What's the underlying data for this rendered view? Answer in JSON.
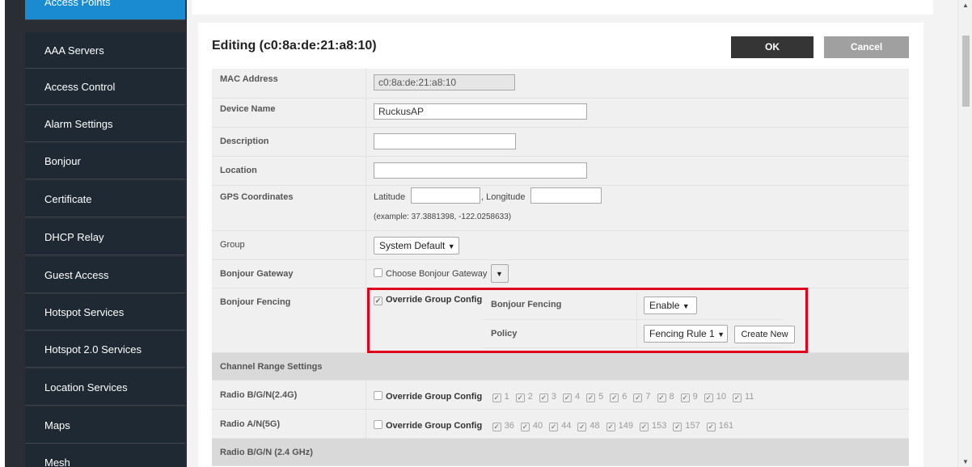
{
  "sidebar": {
    "items": [
      {
        "label": "Access Points",
        "active": true
      },
      {
        "label": "AAA Servers"
      },
      {
        "label": "Access Control"
      },
      {
        "label": "Alarm Settings"
      },
      {
        "label": "Bonjour"
      },
      {
        "label": "Certificate"
      },
      {
        "label": "DHCP Relay"
      },
      {
        "label": "Guest Access"
      },
      {
        "label": "Hotspot Services"
      },
      {
        "label": "Hotspot 2.0 Services"
      },
      {
        "label": "Location Services"
      },
      {
        "label": "Maps"
      },
      {
        "label": "Mesh"
      }
    ]
  },
  "editor": {
    "title": "Editing (c0:8a:de:21:a8:10)",
    "ok_label": "OK",
    "cancel_label": "Cancel"
  },
  "fields": {
    "mac_label": "MAC Address",
    "mac_value": "c0:8a:de:21:a8:10",
    "device_name_label": "Device Name",
    "device_name_value": "RuckusAP",
    "description_label": "Description",
    "description_value": "",
    "location_label": "Location",
    "location_value": "",
    "gps_label": "GPS Coordinates",
    "latitude_label": "Latitude",
    "latitude_value": "",
    "longitude_label": ", Longitude",
    "longitude_value": "",
    "gps_example": "(example: 37.3881398, -122.0258633)",
    "group_label": "Group",
    "group_value": "System Default",
    "bonjour_gateway_label": "Bonjour Gateway",
    "bonjour_gateway_checkbox": "Choose Bonjour Gateway",
    "bonjour_fencing_label": "Bonjour Fencing",
    "fencing_override_label": "Override Group Config",
    "fencing_sub_label": "Bonjour Fencing",
    "fencing_value": "Enable",
    "policy_label": "Policy",
    "policy_value": "Fencing Rule 1",
    "create_new_label": "Create New"
  },
  "channels": {
    "section_title": "Channel Range Settings",
    "radio_24_label": "Radio B/G/N(2.4G)",
    "radio_5_label": "Radio A/N(5G)",
    "override_label": "Override Group Config",
    "channels_24": [
      "1",
      "2",
      "3",
      "4",
      "5",
      "6",
      "7",
      "8",
      "9",
      "10",
      "11"
    ],
    "channels_5": [
      "36",
      "40",
      "44",
      "48",
      "149",
      "153",
      "157",
      "161"
    ],
    "next_section_title": "Radio B/G/N (2.4 GHz)"
  },
  "colors": {
    "sidebar_active": "#1a8bd1",
    "highlight_border": "#e0001b"
  }
}
